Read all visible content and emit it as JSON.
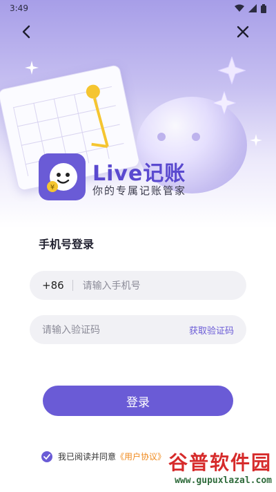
{
  "status_bar": {
    "time": "3:49"
  },
  "brand": {
    "title": "Live记账",
    "subtitle": "你的专属记账管家"
  },
  "login": {
    "section_title": "手机号登录",
    "phone": {
      "prefix": "+86",
      "placeholder": "请输入手机号"
    },
    "code": {
      "placeholder": "请输入验证码",
      "get_code_label": "获取验证码"
    },
    "submit_label": "登录",
    "agreement": {
      "prefix_text": "我已阅读并同意",
      "link_text": "《用户协议》",
      "checked": true
    }
  },
  "watermark": {
    "main": "谷普软件园",
    "url": "www.gupuxlazal.com"
  },
  "colors": {
    "accent": "#6a5bd6",
    "link": "#f08a1d"
  }
}
